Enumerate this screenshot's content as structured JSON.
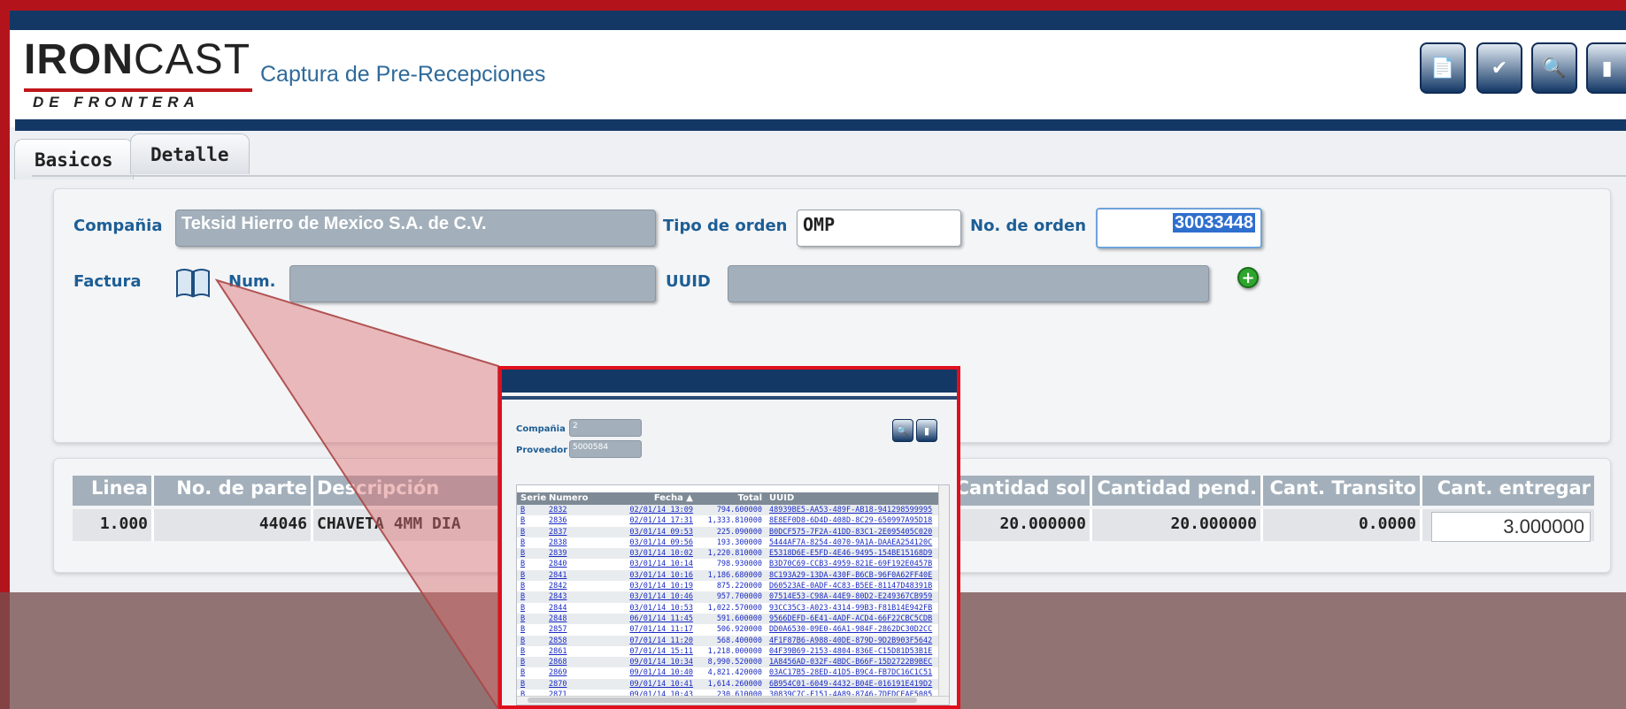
{
  "app": {
    "logo_main_bold": "IRON",
    "logo_main_light": "CAST",
    "logo_sub": "DE FRONTERA",
    "title": "Captura de Pre-Recepciones"
  },
  "toolbar": {
    "buttons": [
      "pdf-icon",
      "approve-icon",
      "search-icon",
      "exit-icon"
    ]
  },
  "tabs": [
    {
      "label": "Basicos",
      "active": false
    },
    {
      "label": "Detalle",
      "active": true
    }
  ],
  "form": {
    "compania_label": "Compañia",
    "compania_value": "Teksid Hierro de Mexico S.A. de C.V.",
    "tipo_orden_label": "Tipo de orden",
    "tipo_orden_value": "OMP",
    "no_orden_label": "No. de orden",
    "no_orden_value": "30033448",
    "factura_label": "Factura",
    "num_label": "Num.",
    "num_value": "",
    "uuid_label": "UUID",
    "uuid_value": ""
  },
  "lines_table": {
    "headers": [
      "Linea",
      "No. de parte",
      "Descripción",
      "Cantidad sol",
      "Cantidad pend.",
      "Cant. Transito",
      "Cant. entregar"
    ],
    "row": {
      "linea": "1.000",
      "parte": "44046",
      "descripcion": "CHAVETA 4MM DIA",
      "cant_sol": "20.000000",
      "cant_pend": "20.000000",
      "cant_transito": "0.0000",
      "cant_entregar": "3.000000"
    }
  },
  "popup": {
    "compania_label": "Compañia",
    "compania_value": "2",
    "proveedor_label": "Proveedor",
    "proveedor_value": "5000584",
    "headers": [
      "Serie",
      "Numero",
      "Fecha ▲",
      "Total",
      "UUID"
    ],
    "rows": [
      [
        "B",
        "2832",
        "02/01/14 13:09",
        "794.600000",
        "48939BE5-AA53-489F-AB18-941298599995"
      ],
      [
        "B",
        "2836",
        "02/01/14 17:31",
        "1,333.810000",
        "8E8EF0D8-6D4D-408D-8C29-650997A95D18"
      ],
      [
        "B",
        "2837",
        "03/01/14 09:53",
        "225.090000",
        "B0DCF575-7F2A-41DD-83C1-2E095405C020"
      ],
      [
        "B",
        "2838",
        "03/01/14 09:56",
        "193.300000",
        "5444AF7A-8254-4070-9A1A-DAAEA254120C"
      ],
      [
        "B",
        "2839",
        "03/01/14 10:02",
        "1,220.810000",
        "E5318D6E-E5FD-4E46-9495-154BE15168D9"
      ],
      [
        "B",
        "2840",
        "03/01/14 10:14",
        "798.930000",
        "B3D70C69-CCB3-4959-821E-69F192E0457B"
      ],
      [
        "B",
        "2841",
        "03/01/14 10:16",
        "1,186.680000",
        "8C193A29-13DA-430F-B6CB-96F0A62FF40E"
      ],
      [
        "B",
        "2842",
        "03/01/14 10:19",
        "875.220000",
        "D60523AE-0ADF-4C83-B5EE-81147D48391B"
      ],
      [
        "B",
        "2843",
        "03/01/14 10:46",
        "957.700000",
        "07514E53-C98A-44E9-80D2-E249367CB959"
      ],
      [
        "B",
        "2844",
        "03/01/14 10:53",
        "1,022.570000",
        "93CC35C3-A023-4314-99B3-F81B14E942FB"
      ],
      [
        "B",
        "2848",
        "06/01/14 11:45",
        "591.600000",
        "9566DEFD-6E41-4ADF-ACD4-66F22CBC5CDB"
      ],
      [
        "B",
        "2857",
        "07/01/14 11:17",
        "506.920000",
        "DD0A6530-09E0-46A1-984F-2862DC30D2CC"
      ],
      [
        "B",
        "2858",
        "07/01/14 11:20",
        "568.400000",
        "4F1F87B6-A988-40DE-879D-9D2B903F5642"
      ],
      [
        "B",
        "2861",
        "07/01/14 15:11",
        "1,218.000000",
        "04F39B69-2153-4804-836E-C15D81D53B1E"
      ],
      [
        "B",
        "2868",
        "09/01/14 10:34",
        "8,990.520000",
        "1A8456AD-032F-4BDC-B66F-15D2722B9BEC"
      ],
      [
        "B",
        "2869",
        "09/01/14 10:40",
        "4,821.420000",
        "03AC17B5-28ED-41D5-B9C4-FB7DC16C1C51"
      ],
      [
        "B",
        "2870",
        "09/01/14 10:41",
        "1,614.260000",
        "6B954C01-6049-4432-B04E-016191E419D2"
      ],
      [
        "B",
        "2871",
        "09/01/14 10:43",
        "230.610000",
        "30839C7C-F151-4A89-8746-7DEDCEAE5085"
      ]
    ]
  }
}
